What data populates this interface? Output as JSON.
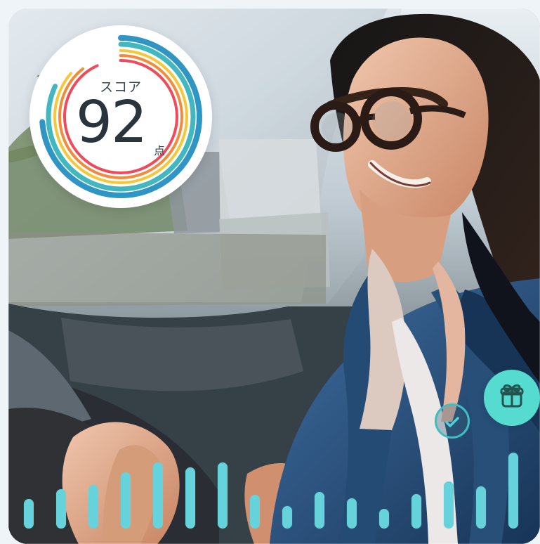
{
  "score_card": {
    "label": "スコア",
    "value": "92",
    "unit": "点"
  },
  "icons": {
    "check": "check-circle-icon",
    "gift": "gift-icon"
  },
  "colors": {
    "bar": "#66d3dc",
    "ring_blue": "#2e95c4",
    "ring_teal": "#42b7bf",
    "ring_yellow": "#f6c739",
    "ring_orange": "#f28b3b",
    "ring_red": "#ef4b5d",
    "gift_bg": "#55dbcf"
  },
  "activity_levels": [
    0.3,
    0.4,
    0.44,
    0.57,
    0.67,
    0.62,
    0.67,
    0.34,
    0.23,
    0.37,
    0.31,
    0.2,
    0.35,
    0.48,
    0.43,
    0.77
  ]
}
